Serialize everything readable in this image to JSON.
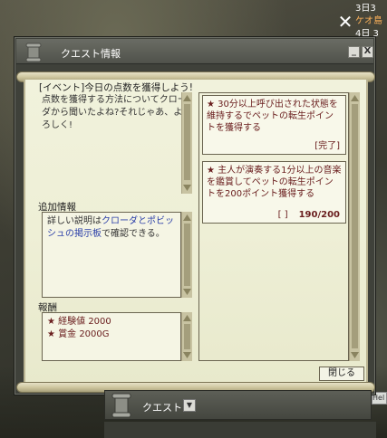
{
  "window": {
    "title": "クエスト情報",
    "minimize_label": "_",
    "close_label": "X"
  },
  "quest": {
    "title": "[イベント]今日の点数を獲得しよう!",
    "description": "点数を獲得する方法についてクローダから聞いたよね?それじゃあ、よろしく!",
    "additional_info_label": "追加情報",
    "additional_info": {
      "prefix": "詳しい説明は",
      "link": "クローダとポビッシュの掲示板",
      "suffix": "で確認できる。"
    },
    "reward_label": "報酬",
    "rewards": [
      "★ 経験値 2000",
      "★ 賞金 2000G"
    ]
  },
  "tasks": [
    {
      "text": "★ 30分以上呼び出された状態を維持するでペットの転生ポイントを獲得する",
      "status": "[完了]"
    },
    {
      "text": "★ 主人が演奏する1分以上の音楽を鑑賞してペットの転生ポイントを200ポイント獲得する",
      "progress_bracket": "[ ]",
      "progress": "190/200"
    }
  ],
  "close_button_label": "閉じる",
  "questbar": {
    "label": "クエスト",
    "dropdown_icon": "▼"
  },
  "side": {
    "close_icon_glyph": "✕",
    "line1": "3日3",
    "line2": "ケオ島",
    "line3": "4日 3",
    "help_label": "Hel"
  }
}
